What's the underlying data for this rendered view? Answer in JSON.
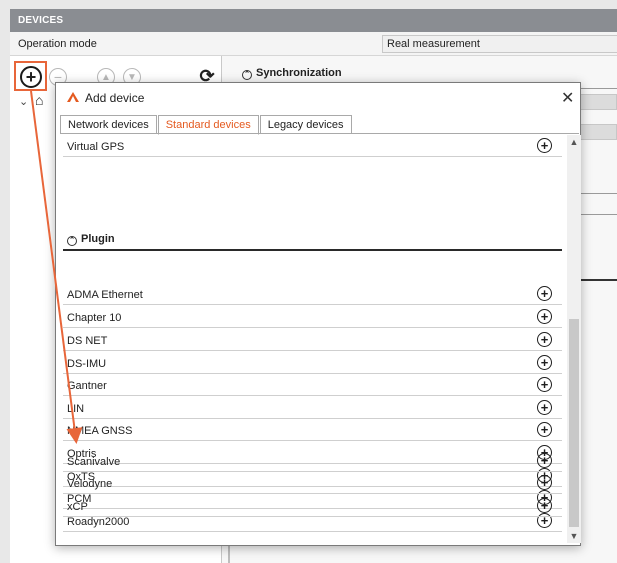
{
  "devices_panel": {
    "header": "DEVICES",
    "operation_mode_label": "Operation mode",
    "operation_mode_value": "Real measurement",
    "sync_header": "Synchronization",
    "toolbar": {
      "add_icon": "⊕",
      "remove_icon": "−",
      "up_icon": "▲",
      "down_icon": "▼",
      "refresh_icon": "⟳"
    }
  },
  "dialog": {
    "title": "Add device",
    "close_glyph": "✕",
    "tabs": [
      {
        "label": "Network devices"
      },
      {
        "label": "Standard devices"
      },
      {
        "label": "Legacy devices"
      }
    ],
    "top_item": "Virtual GPS",
    "section_title": "Plugin",
    "plugins": [
      "ADMA Ethernet",
      "Chapter 10",
      "DS NET",
      "DS-IMU",
      "Gantner",
      "LIN",
      "NMEA GNSS",
      "Optris",
      "OxTS",
      "PCM",
      "Roadyn2000",
      "Scanivalve",
      "Velodyne",
      "xCP"
    ],
    "plus_glyph": "+",
    "colors": {
      "accent": "#e45a20",
      "highlight": "#e8663a"
    }
  }
}
